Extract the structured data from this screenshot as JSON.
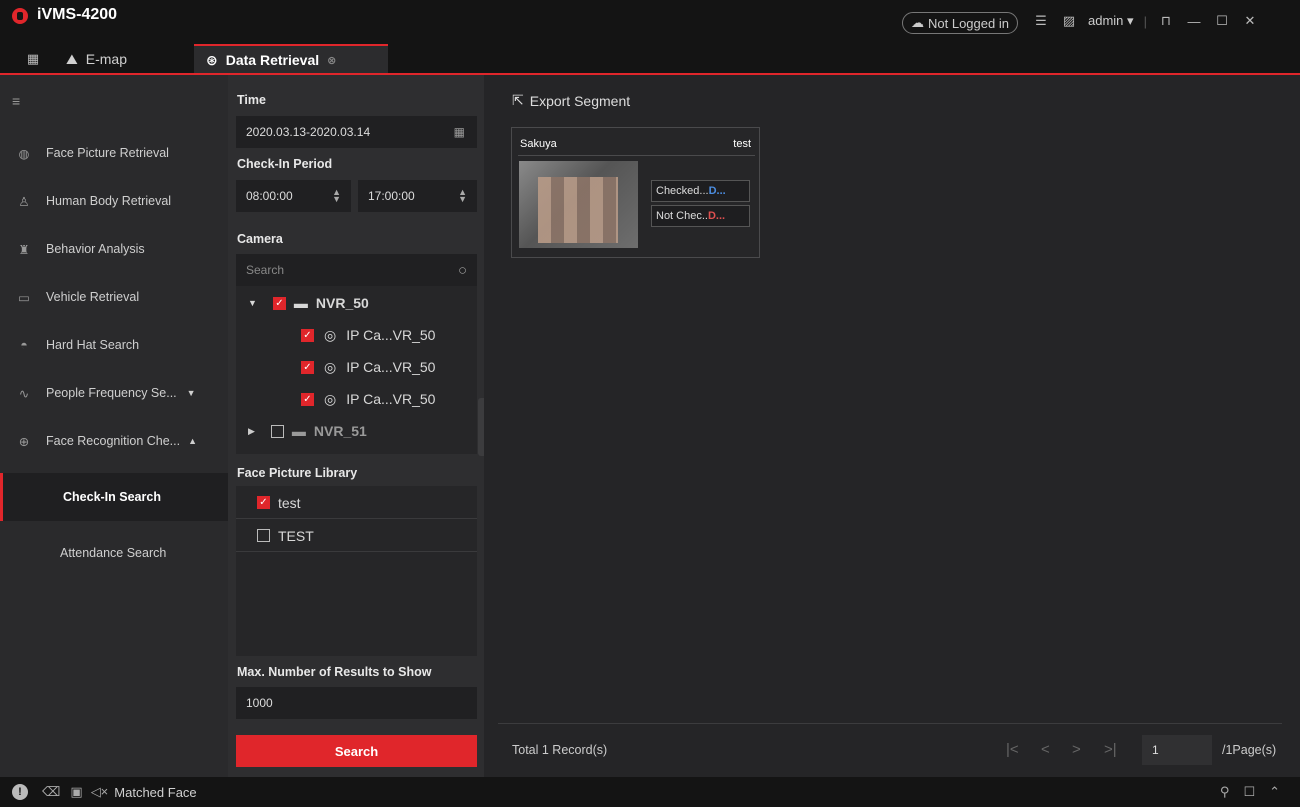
{
  "app": {
    "title": "iVMS-4200"
  },
  "titlebar": {
    "login_status": "Not Logged in",
    "user": "admin"
  },
  "tabs": [
    {
      "label": "E-map"
    },
    {
      "label": "Data Retrieval"
    }
  ],
  "nav": {
    "items": [
      {
        "label": "Face Picture Retrieval"
      },
      {
        "label": "Human Body Retrieval"
      },
      {
        "label": "Behavior Analysis"
      },
      {
        "label": "Vehicle Retrieval"
      },
      {
        "label": "Hard Hat Search"
      },
      {
        "label": "People Frequency Se..."
      },
      {
        "label": "Face Recognition Che..."
      },
      {
        "label": "Check-In Search"
      },
      {
        "label": "Attendance Search"
      }
    ]
  },
  "filters": {
    "time_label": "Time",
    "time_value": "2020.03.13-2020.03.14",
    "period_label": "Check-In Period",
    "start": "08:00:00",
    "end": "17:00:00",
    "camera_label": "Camera",
    "search_placeholder": "Search",
    "tree": [
      {
        "label": "NVR_50",
        "checked": true
      },
      {
        "label": "IP Ca...VR_50",
        "checked": true
      },
      {
        "label": "IP Ca...VR_50",
        "checked": true
      },
      {
        "label": "IP Ca...VR_50",
        "checked": true
      },
      {
        "label": "NVR_51",
        "checked": false
      }
    ],
    "library_label": "Face Picture Library",
    "libraries": [
      {
        "label": "test",
        "checked": true
      },
      {
        "label": "TEST",
        "checked": false
      }
    ],
    "max_label": "Max. Number of Results to Show",
    "max_value": "1000",
    "search_button": "Search"
  },
  "results": {
    "export_label": "Export Segment",
    "card": {
      "name": "Sakuya",
      "library": "test",
      "checked_label": "Checked...",
      "checked_suffix": "D...",
      "not_checked_label": "Not Chec..",
      "not_checked_suffix": "D..."
    },
    "total": "Total 1 Record(s)",
    "page": "1",
    "page_total": "/1Page(s)"
  },
  "statusbar": {
    "label": "Matched Face"
  }
}
